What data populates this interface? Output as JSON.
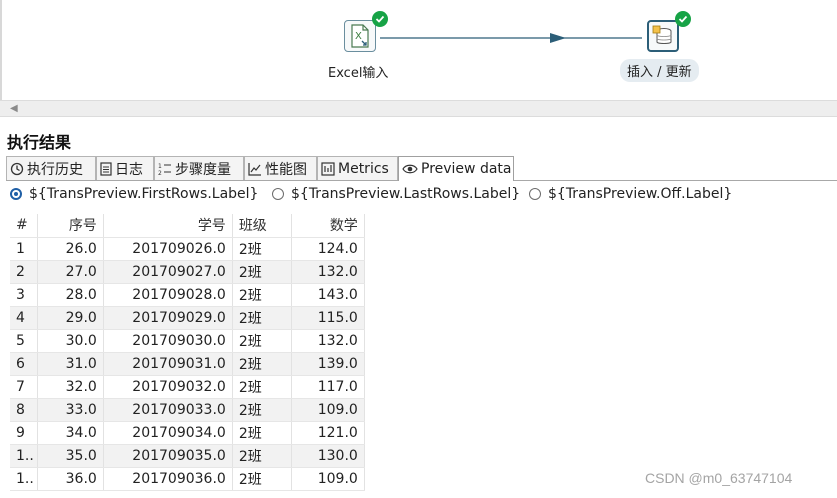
{
  "canvas": {
    "steps": [
      {
        "label": "Excel输入",
        "icon": "excel-file-icon",
        "status": "success"
      },
      {
        "label": "插入 / 更新",
        "icon": "database-update-icon",
        "status": "success"
      }
    ]
  },
  "results": {
    "title": "执行结果",
    "tabs": [
      {
        "label": "执行历史",
        "icon": "history-icon"
      },
      {
        "label": "日志",
        "icon": "log-icon"
      },
      {
        "label": "步骤度量",
        "icon": "step-metrics-icon"
      },
      {
        "label": "性能图",
        "icon": "performance-graph-icon"
      },
      {
        "label": "Metrics",
        "icon": "metrics-icon"
      },
      {
        "label": "Preview data",
        "icon": "eye-icon",
        "active": true
      }
    ],
    "radios": [
      {
        "label": "${TransPreview.FirstRows.Label}",
        "selected": true
      },
      {
        "label": "${TransPreview.LastRows.Label}",
        "selected": false
      },
      {
        "label": "${TransPreview.Off.Label}",
        "selected": false
      }
    ]
  },
  "table": {
    "columns": [
      "#",
      "序号",
      "学号",
      "班级",
      "数学"
    ],
    "rows": [
      [
        "1",
        "26.0",
        "201709026.0",
        "2班",
        "124.0"
      ],
      [
        "2",
        "27.0",
        "201709027.0",
        "2班",
        "132.0"
      ],
      [
        "3",
        "28.0",
        "201709028.0",
        "2班",
        "143.0"
      ],
      [
        "4",
        "29.0",
        "201709029.0",
        "2班",
        "115.0"
      ],
      [
        "5",
        "30.0",
        "201709030.0",
        "2班",
        "132.0"
      ],
      [
        "6",
        "31.0",
        "201709031.0",
        "2班",
        "139.0"
      ],
      [
        "7",
        "32.0",
        "201709032.0",
        "2班",
        "117.0"
      ],
      [
        "8",
        "33.0",
        "201709033.0",
        "2班",
        "109.0"
      ],
      [
        "9",
        "34.0",
        "201709034.0",
        "2班",
        "121.0"
      ],
      [
        "1..",
        "35.0",
        "201709035.0",
        "2班",
        "130.0"
      ],
      [
        "1..",
        "36.0",
        "201709036.0",
        "2班",
        "109.0"
      ]
    ]
  },
  "watermark": "CSDN @m0_63747104",
  "colors": {
    "success": "#17a346",
    "radio_selected": "#1f5fa6",
    "hop": "#2c5e78"
  }
}
